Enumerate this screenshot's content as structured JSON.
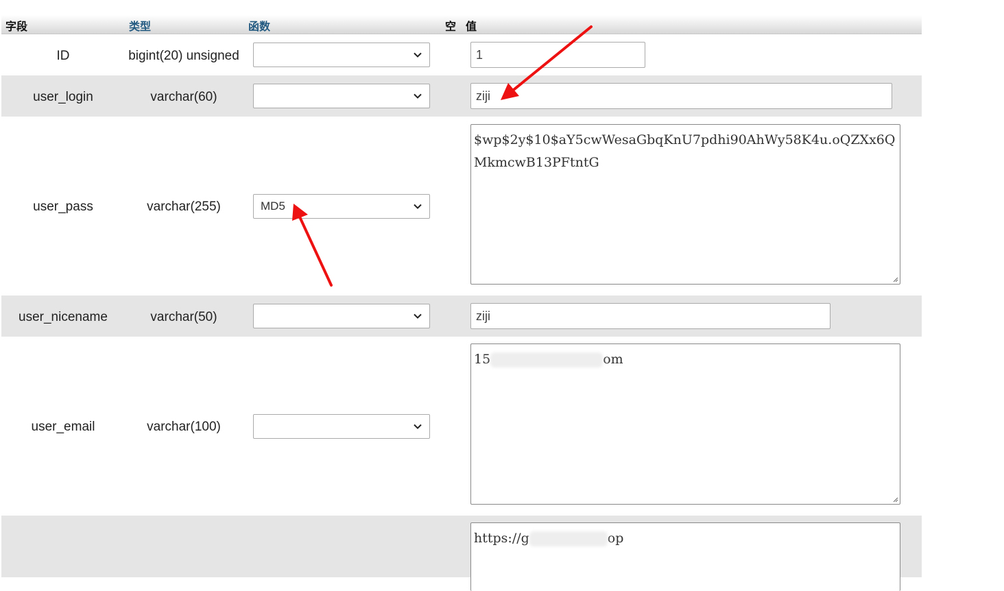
{
  "header": {
    "field": "字段",
    "type": "类型",
    "function": "函数",
    "null": "空",
    "value": "值"
  },
  "rows": [
    {
      "name": "ID",
      "type": "bigint(20) unsigned",
      "function": "",
      "value": "1"
    },
    {
      "name": "user_login",
      "type": "varchar(60)",
      "function": "",
      "value": "ziji"
    },
    {
      "name": "user_pass",
      "type": "varchar(255)",
      "function": "MD5",
      "value": "$wp$2y$10$aY5cwWesaGbqKnU7pdhi90AhWy58K4u.oQZXx6QMkmcwB13PFtntG"
    },
    {
      "name": "user_nicename",
      "type": "varchar(50)",
      "function": "",
      "value": "ziji"
    },
    {
      "name": "user_email",
      "type": "varchar(100)",
      "function": "",
      "value_prefix": "15",
      "value_suffix": "om"
    },
    {
      "name": "",
      "type": "",
      "function": "",
      "value_prefix": "https://g",
      "value_suffix": "op"
    }
  ],
  "icons": {
    "select_arrow": "chevron-down-icon",
    "resize": "resize-handle-icon",
    "annotation": "red-arrow-icon"
  },
  "colors": {
    "header_link": "#235a81",
    "row_alt": "#e5e5e5",
    "annotation": "#ee1111"
  }
}
